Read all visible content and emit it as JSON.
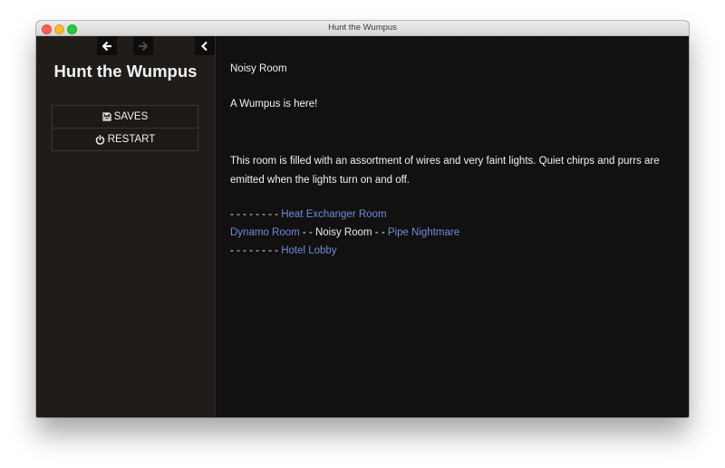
{
  "window": {
    "title": "Hunt the Wumpus"
  },
  "sidebar": {
    "title": "Hunt the Wumpus",
    "nav": {
      "back_icon": "arrow-left-icon",
      "forward_icon": "arrow-right-icon",
      "collapse_icon": "chevron-left-icon"
    },
    "menu": [
      {
        "icon": "floppy-disk-icon",
        "label": "SAVES"
      },
      {
        "icon": "power-icon",
        "label": "RESTART"
      }
    ]
  },
  "main": {
    "room_name": "Noisy Room",
    "event": "A Wumpus is here!",
    "description": "This room is filled with an assortment of wires and very faint lights. Quiet chirps and purrs are emitted when the lights turn on and off.",
    "map": {
      "north_prefix": "- - - - - - - - ",
      "north": "Heat Exchanger Room",
      "west": "Dynamo Room",
      "west_sep": " - - ",
      "current": "Noisy Room",
      "east_sep": " - - ",
      "east": "Pipe Nightmare",
      "south_prefix": "- - - - - - - - ",
      "south": "Hotel Lobby"
    }
  },
  "colors": {
    "link": "#6e8cd8",
    "background": "#121010",
    "sidebar": "#201c1a",
    "text": "#f2f2f2"
  }
}
